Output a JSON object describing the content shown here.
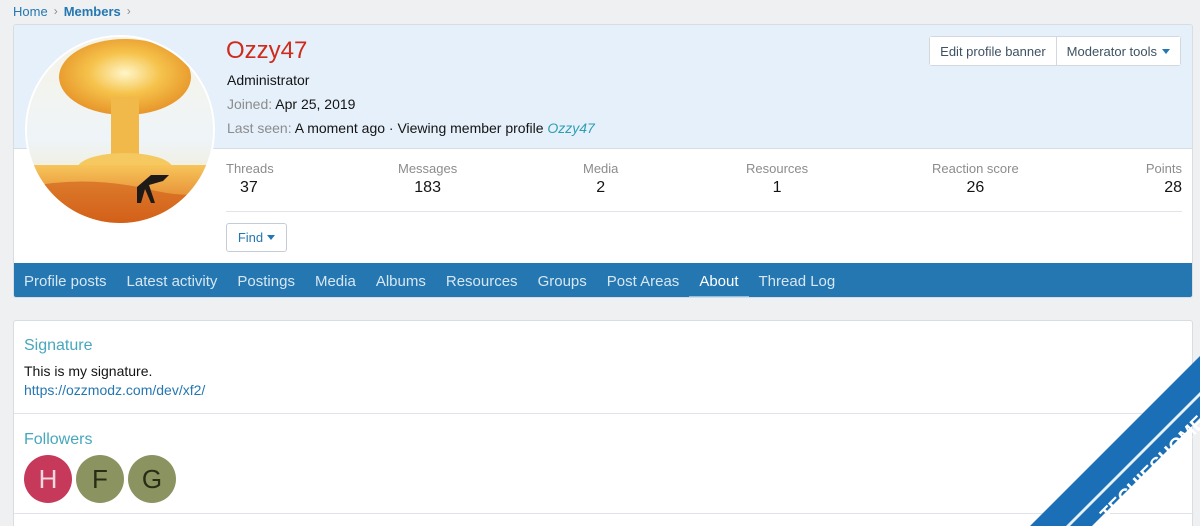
{
  "breadcrumb": {
    "home": "Home",
    "current": "Members",
    "sep": "›"
  },
  "profile": {
    "username": "Ozzy47",
    "title": "Administrator",
    "joined_label": "Joined:",
    "joined_value": "Apr 25, 2019",
    "lastseen_label": "Last seen:",
    "lastseen_value": "A moment ago · Viewing member profile",
    "lastseen_member": "Ozzy47",
    "username_color": "#cf2a1b"
  },
  "banner_buttons": {
    "edit_banner": "Edit profile banner",
    "moderator_tools": "Moderator tools"
  },
  "stats": [
    {
      "label": "Threads",
      "value": "37"
    },
    {
      "label": "Messages",
      "value": "183"
    },
    {
      "label": "Media",
      "value": "2"
    },
    {
      "label": "Resources",
      "value": "1"
    },
    {
      "label": "Reaction score",
      "value": "26"
    },
    {
      "label": "Points",
      "value": "28"
    }
  ],
  "find": {
    "label": "Find"
  },
  "tabs": [
    {
      "label": "Profile posts"
    },
    {
      "label": "Latest activity"
    },
    {
      "label": "Postings"
    },
    {
      "label": "Media"
    },
    {
      "label": "Albums"
    },
    {
      "label": "Resources"
    },
    {
      "label": "Groups"
    },
    {
      "label": "Post Areas"
    },
    {
      "label": "About",
      "active": true
    },
    {
      "label": "Thread Log"
    }
  ],
  "about": {
    "signature_title": "Signature",
    "signature_text": "This is my signature.",
    "signature_link": "https://ozzmodz.com/dev/xf2/",
    "followers_title": "Followers",
    "followers": [
      {
        "letter": "H",
        "bg": "#c6395a",
        "fg": "#f4d9df"
      },
      {
        "letter": "F",
        "bg": "#8b9460",
        "fg": "#2a2c14"
      },
      {
        "letter": "G",
        "bg": "#8b9460",
        "fg": "#2a2c14"
      }
    ]
  },
  "watermark": {
    "text": "TECHIESHOME.COM",
    "color": "#1b6fb6"
  },
  "colors": {
    "accent": "#2577b1",
    "tab_bar": "#2577b1"
  }
}
